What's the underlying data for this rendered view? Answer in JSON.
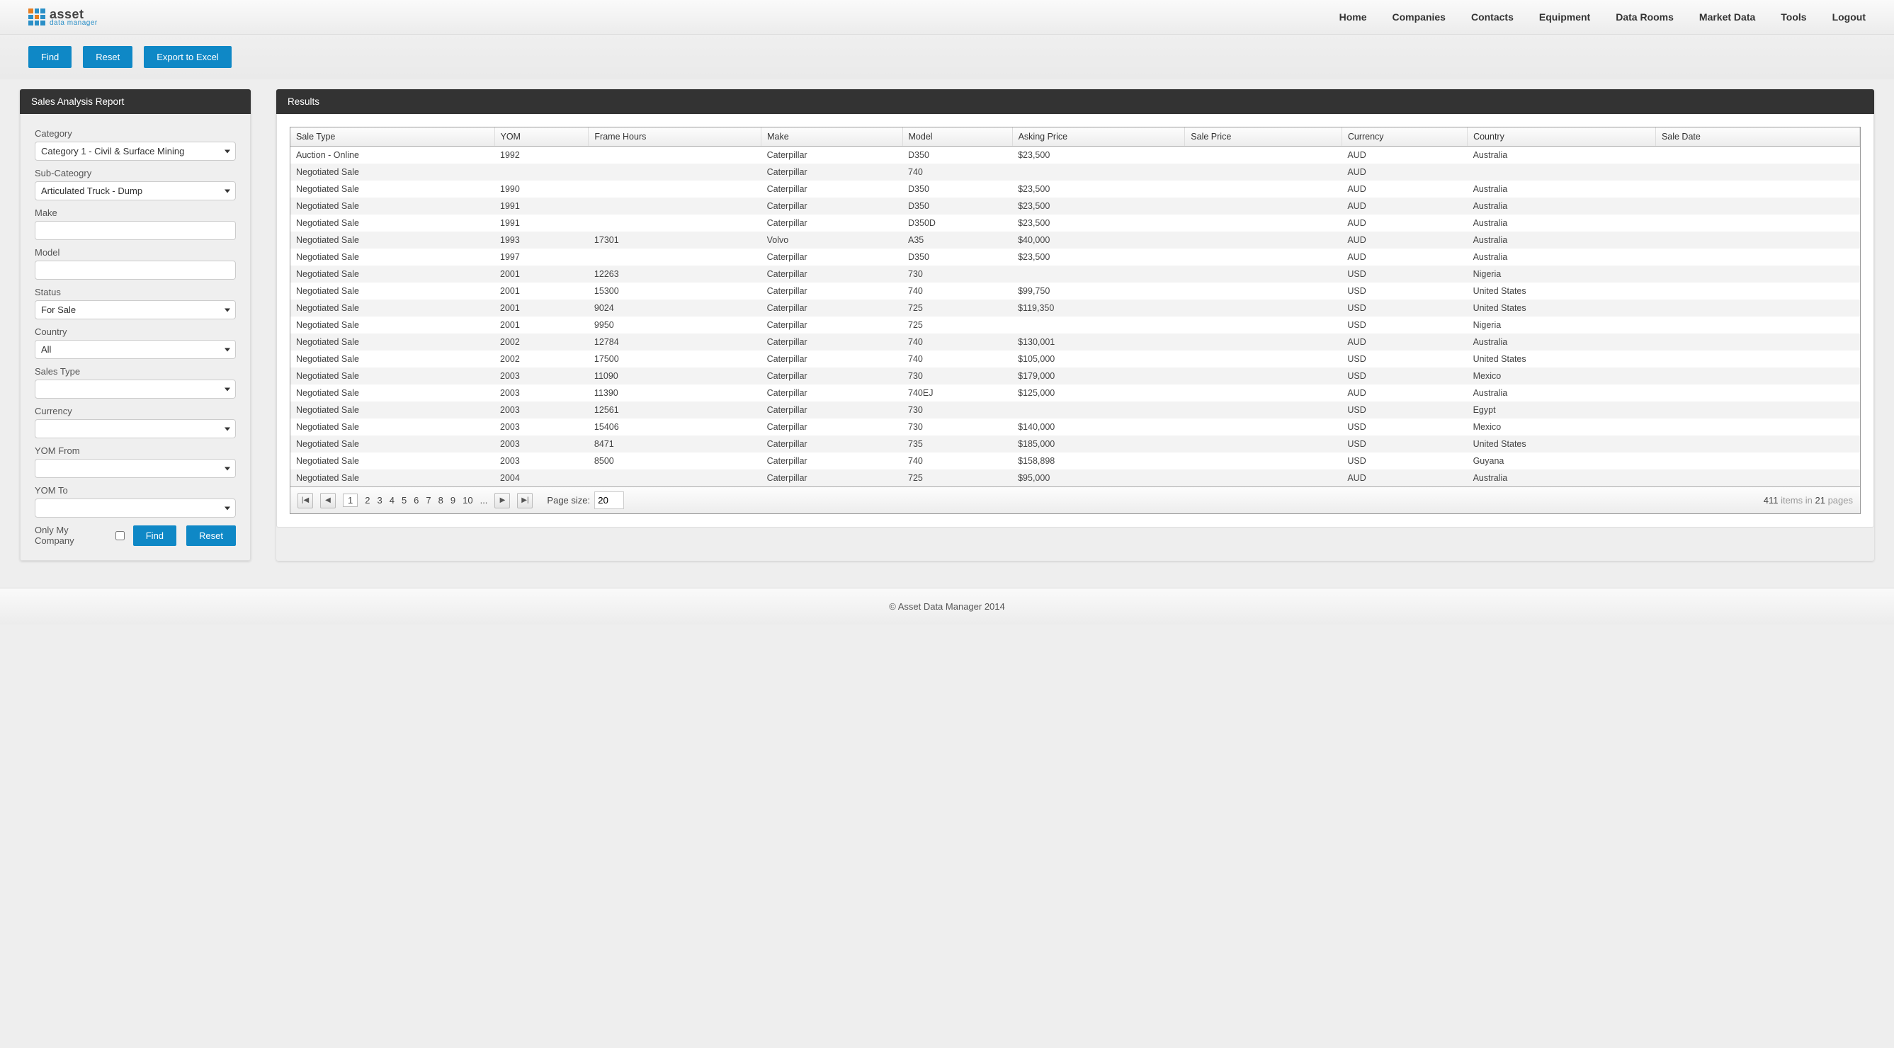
{
  "logo": {
    "main": "asset",
    "sub": "data manager"
  },
  "nav": [
    "Home",
    "Companies",
    "Contacts",
    "Equipment",
    "Data Rooms",
    "Market Data",
    "Tools",
    "Logout"
  ],
  "toolbar": {
    "find": "Find",
    "reset": "Reset",
    "export": "Export to Excel"
  },
  "sidebar": {
    "title": "Sales Analysis Report",
    "labels": {
      "category": "Category",
      "subcategory": "Sub-Cateogry",
      "make": "Make",
      "model": "Model",
      "status": "Status",
      "country": "Country",
      "salesType": "Sales Type",
      "currency": "Currency",
      "yomFrom": "YOM From",
      "yomTo": "YOM To",
      "onlyMy": "Only My Company"
    },
    "values": {
      "category": "Category 1 - Civil & Surface Mining",
      "subcategory": "Articulated Truck - Dump",
      "make": "",
      "model": "",
      "status": "For Sale",
      "country": "All",
      "salesType": "",
      "currency": "",
      "yomFrom": "",
      "yomTo": ""
    },
    "buttons": {
      "find": "Find",
      "reset": "Reset"
    }
  },
  "results": {
    "title": "Results",
    "columns": [
      "Sale Type",
      "YOM",
      "Frame Hours",
      "Make",
      "Model",
      "Asking Price",
      "Sale Price",
      "Currency",
      "Country",
      "Sale Date"
    ],
    "rows": [
      [
        "Auction - Online",
        "1992",
        "",
        "Caterpillar",
        "D350",
        "$23,500",
        "",
        "AUD",
        "Australia",
        ""
      ],
      [
        "Negotiated Sale",
        "",
        "",
        "Caterpillar",
        "740",
        "",
        "",
        "AUD",
        "",
        ""
      ],
      [
        "Negotiated Sale",
        "1990",
        "",
        "Caterpillar",
        "D350",
        "$23,500",
        "",
        "AUD",
        "Australia",
        ""
      ],
      [
        "Negotiated Sale",
        "1991",
        "",
        "Caterpillar",
        "D350",
        "$23,500",
        "",
        "AUD",
        "Australia",
        ""
      ],
      [
        "Negotiated Sale",
        "1991",
        "",
        "Caterpillar",
        "D350D",
        "$23,500",
        "",
        "AUD",
        "Australia",
        ""
      ],
      [
        "Negotiated Sale",
        "1993",
        "17301",
        "Volvo",
        "A35",
        "$40,000",
        "",
        "AUD",
        "Australia",
        ""
      ],
      [
        "Negotiated Sale",
        "1997",
        "",
        "Caterpillar",
        "D350",
        "$23,500",
        "",
        "AUD",
        "Australia",
        ""
      ],
      [
        "Negotiated Sale",
        "2001",
        "12263",
        "Caterpillar",
        "730",
        "",
        "",
        "USD",
        "Nigeria",
        ""
      ],
      [
        "Negotiated Sale",
        "2001",
        "15300",
        "Caterpillar",
        "740",
        "$99,750",
        "",
        "USD",
        "United States",
        ""
      ],
      [
        "Negotiated Sale",
        "2001",
        "9024",
        "Caterpillar",
        "725",
        "$119,350",
        "",
        "USD",
        "United States",
        ""
      ],
      [
        "Negotiated Sale",
        "2001",
        "9950",
        "Caterpillar",
        "725",
        "",
        "",
        "USD",
        "Nigeria",
        ""
      ],
      [
        "Negotiated Sale",
        "2002",
        "12784",
        "Caterpillar",
        "740",
        "$130,001",
        "",
        "AUD",
        "Australia",
        ""
      ],
      [
        "Negotiated Sale",
        "2002",
        "17500",
        "Caterpillar",
        "740",
        "$105,000",
        "",
        "USD",
        "United States",
        ""
      ],
      [
        "Negotiated Sale",
        "2003",
        "11090",
        "Caterpillar",
        "730",
        "$179,000",
        "",
        "USD",
        "Mexico",
        ""
      ],
      [
        "Negotiated Sale",
        "2003",
        "11390",
        "Caterpillar",
        "740EJ",
        "$125,000",
        "",
        "AUD",
        "Australia",
        ""
      ],
      [
        "Negotiated Sale",
        "2003",
        "12561",
        "Caterpillar",
        "730",
        "",
        "",
        "USD",
        "Egypt",
        ""
      ],
      [
        "Negotiated Sale",
        "2003",
        "15406",
        "Caterpillar",
        "730",
        "$140,000",
        "",
        "USD",
        "Mexico",
        ""
      ],
      [
        "Negotiated Sale",
        "2003",
        "8471",
        "Caterpillar",
        "735",
        "$185,000",
        "",
        "USD",
        "United States",
        ""
      ],
      [
        "Negotiated Sale",
        "2003",
        "8500",
        "Caterpillar",
        "740",
        "$158,898",
        "",
        "USD",
        "Guyana",
        ""
      ],
      [
        "Negotiated Sale",
        "2004",
        "",
        "Caterpillar",
        "725",
        "$95,000",
        "",
        "AUD",
        "Australia",
        ""
      ]
    ],
    "pager": {
      "pages": [
        "1",
        "2",
        "3",
        "4",
        "5",
        "6",
        "7",
        "8",
        "9",
        "10",
        "..."
      ],
      "current": "1",
      "pageSizeLabel": "Page size:",
      "pageSize": "20",
      "totalItems": "411",
      "itemsText": "items in",
      "totalPages": "21",
      "pagesText": "pages"
    }
  },
  "footer": "© Asset Data Manager 2014"
}
